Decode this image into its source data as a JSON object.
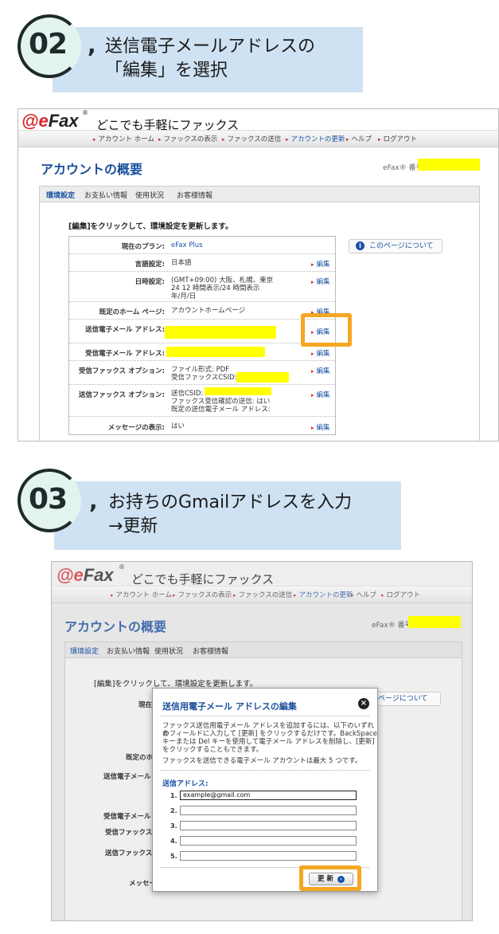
{
  "step2": {
    "number": "02",
    "line1": "送信電子メールアドレスの",
    "line2": "「編集」を選択"
  },
  "step3": {
    "number": "03",
    "line1": "お持ちのGmailアドレスを入力",
    "line2": "→更新"
  },
  "efax": {
    "logo_e": "e",
    "logo_fax": "Fax",
    "logo_reg": "®",
    "tagline": "どこでも手軽にファックス",
    "nav": [
      "アカウント ホーム",
      "ファックスの表示",
      "ファックスの送信",
      "アカウントの更新",
      "ヘルプ",
      "ログアウト"
    ],
    "account_title": "アカウントの概要",
    "fax_number_label": "eFax® 番号:",
    "tabs": [
      "環境設定",
      "お支払い情報",
      "使用状況",
      "お客様情報"
    ],
    "instruction": "[編集]をクリックして、環境設定を更新します。",
    "about_link": "このページについて",
    "about_link_partial": "ページについて",
    "edit_label": "編集",
    "rows": [
      {
        "label": "現在のプラン:",
        "value": "eFax Plus"
      },
      {
        "label": "言語設定:",
        "value": "日本語"
      },
      {
        "label": "日時設定:",
        "value_lines": [
          "(GMT+09:00) 大阪、札幌、東京",
          "24 12 時間表示/24 時間表示",
          "年/月/日"
        ]
      },
      {
        "label": "既定のホーム ページ:",
        "value": "アカウントホームページ"
      },
      {
        "label": "送信電子メール アドレス:",
        "value": ""
      },
      {
        "label": "受信電子メール アドレス:",
        "value": ""
      },
      {
        "label": "受信ファックス オプション:",
        "value_lines": [
          "ファイル形式: PDF",
          "受信ファックスCSID:"
        ]
      },
      {
        "label": "送信ファックス オプション:",
        "value_lines": [
          "送信CSID:",
          "ファックス受信確認の送信: はい",
          "既定の送信電子メール アドレス:"
        ]
      },
      {
        "label": "メッセージの表示:",
        "value": "はい"
      }
    ],
    "row_labels_partial": [
      "現在の",
      "既定のホーム",
      "送信電子メール",
      "受信電子メール",
      "受信ファックス オ",
      "送信ファックス オ",
      "メッセー"
    ]
  },
  "modal": {
    "title": "送信用電子メール アドレスの編集",
    "desc_lines": [
      "ファックス送信用電子メール アドレスを追加するには、以下のいずれか",
      "のフィールドに入力して [更新] をクリックするだけです。BackSpace",
      "キーまたは Del キーを使用して電子メール アドレスを削除し、[更新]",
      "をクリックすることもできます。"
    ],
    "max_note": "ファックスを送信できる電子メール アカウントは最大 5 つです。",
    "section_label": "送信アドレス:",
    "fields": [
      {
        "num": "1.",
        "value": "example@gmail.com"
      },
      {
        "num": "2.",
        "value": ""
      },
      {
        "num": "3.",
        "value": ""
      },
      {
        "num": "4.",
        "value": ""
      },
      {
        "num": "5.",
        "value": ""
      }
    ],
    "update_button": "更 新",
    "go_glyph": "›",
    "close_glyph": "×"
  },
  "colors": {
    "step_bg": "#cfe2f3",
    "circle_bg": "#e3f4ef",
    "highlight": "#f5a623",
    "redacted": "#ffff00",
    "link": "#1a52a5"
  }
}
